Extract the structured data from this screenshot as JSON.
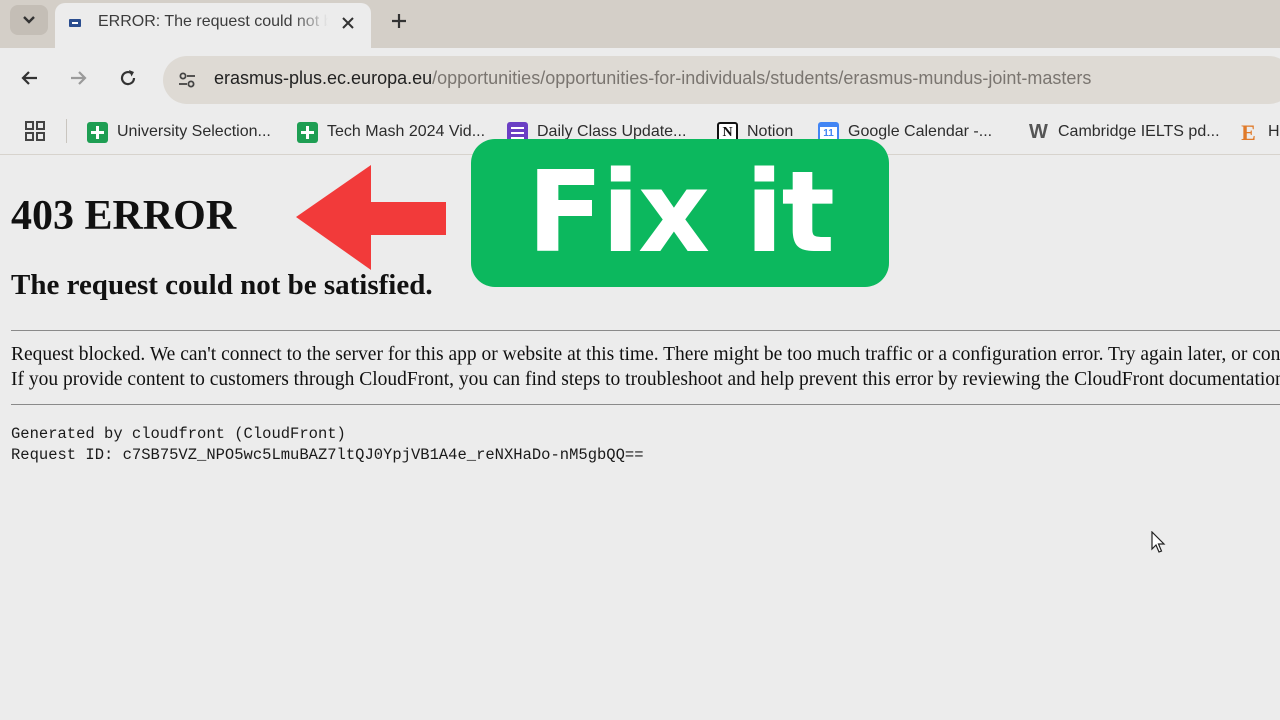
{
  "browser": {
    "tab": {
      "title": "ERROR: The request could not be satisfied"
    },
    "address_bar": {
      "host": "erasmus-plus.ec.europa.eu",
      "path": "/opportunities/opportunities-for-individuals/students/erasmus-mundus-joint-masters"
    },
    "bookmarks": [
      {
        "label": "University Selection...",
        "icon": "sheets-icon"
      },
      {
        "label": "Tech Mash 2024 Vid...",
        "icon": "sheets-icon"
      },
      {
        "label": "Daily Class Update...",
        "icon": "forms-icon"
      },
      {
        "label": "Notion",
        "icon": "notion-icon",
        "icon_text": "N"
      },
      {
        "label": "Google Calendar -...",
        "icon": "calendar-icon",
        "icon_text": "11"
      },
      {
        "label": "Cambridge IELTS pd...",
        "icon": "weebly-icon",
        "icon_text": "W"
      },
      {
        "label": "H",
        "icon": "e-icon",
        "icon_text": "E"
      }
    ]
  },
  "page": {
    "heading": "403 ERROR",
    "subheading": "The request could not be satisfied.",
    "message_line1": "Request blocked. We can't connect to the server for this app or website at this time. There might be too much traffic or a configuration error. Try again later, or contact the app or website owner.",
    "message_line2": "If you provide content to customers through CloudFront, you can find steps to troubleshoot and help prevent this error by reviewing the CloudFront documentation.",
    "generated_by": "Generated by cloudfront (CloudFront)",
    "request_id": "Request ID: c7SB75VZ_NPO5wc5LmuBAZ7ltQJ0YpjVB1A4e_reNXHaDo-nM5gbQQ=="
  },
  "overlay": {
    "badge_text": "Fix it",
    "badge_color": "#0cb85e",
    "arrow_color": "#f23a3a"
  }
}
